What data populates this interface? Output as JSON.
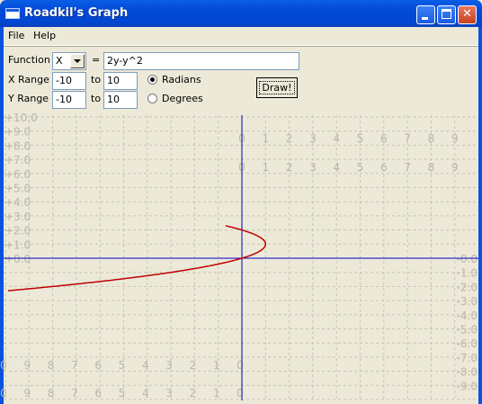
{
  "window": {
    "title": "Roadkil's Graph"
  },
  "menu": [
    "File",
    "Help"
  ],
  "form": {
    "function_label": "Function",
    "function_var": "X",
    "equals": "=",
    "expression": "2y-y^2",
    "xrange_label": "X Range",
    "xrange_from": "-10",
    "xrange_to": "10",
    "yrange_label": "Y Range",
    "yrange_from": "-10",
    "yrange_to": "10",
    "to": "to",
    "radians_label": "Radians",
    "degrees_label": "Degrees",
    "angle_mode": "Radians",
    "draw_label": "Draw!"
  },
  "graph": {
    "y_ticks_left": [
      "+10.0",
      "+9.0",
      "+8.0",
      "+7.0",
      "+6.0",
      "+5.0",
      "+4.0",
      "+3.0",
      "+2.0",
      "+1.0",
      "+0.0"
    ],
    "y_ticks_right": [
      "-0.0",
      "-1.0",
      "-2.0",
      "-3.0",
      "-4.0",
      "-5.0",
      "-6.0",
      "-7.0",
      "-8.0",
      "-9.0"
    ],
    "x_ticks_pos": [
      "0",
      "1",
      "2",
      "3",
      "4",
      "5",
      "6",
      "7",
      "8",
      "9"
    ],
    "x_ticks_neg": [
      "0",
      "9",
      "8",
      "7",
      "6",
      "5",
      "4",
      "3",
      "2",
      "1",
      "0"
    ],
    "curve_color": "#c00000",
    "axis_color": "#0000cc",
    "grid_color": "#c8c4b4"
  },
  "chart_data": {
    "type": "line",
    "series": [
      {
        "values_expression": "x = 2y - y^2"
      }
    ],
    "xlim": [
      -10,
      10
    ],
    "ylim": [
      -10,
      10
    ],
    "grid": true
  }
}
